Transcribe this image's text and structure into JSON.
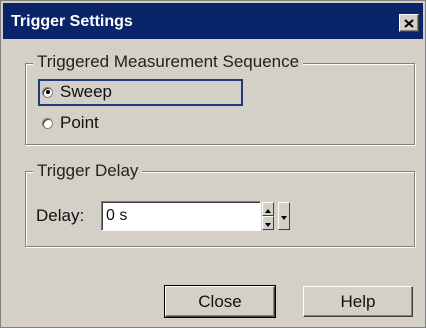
{
  "window": {
    "title": "Trigger Settings"
  },
  "sequence_group": {
    "legend": "Triggered Measurement Sequence",
    "options": [
      {
        "label": "Sweep",
        "selected": true
      },
      {
        "label": "Point",
        "selected": false
      }
    ]
  },
  "delay_group": {
    "legend": "Trigger Delay",
    "delay_label": "Delay:",
    "delay_value": "0 s"
  },
  "buttons": {
    "close": "Close",
    "help": "Help"
  },
  "icons": {
    "title_close": "close-icon",
    "spin_up": "arrow-up-icon",
    "spin_down": "arrow-down-icon",
    "dropdown": "triangle-down-icon"
  },
  "colors": {
    "titlebar": "#0a246a",
    "face": "#d4d0c8",
    "focus": "#1f3a7a"
  }
}
